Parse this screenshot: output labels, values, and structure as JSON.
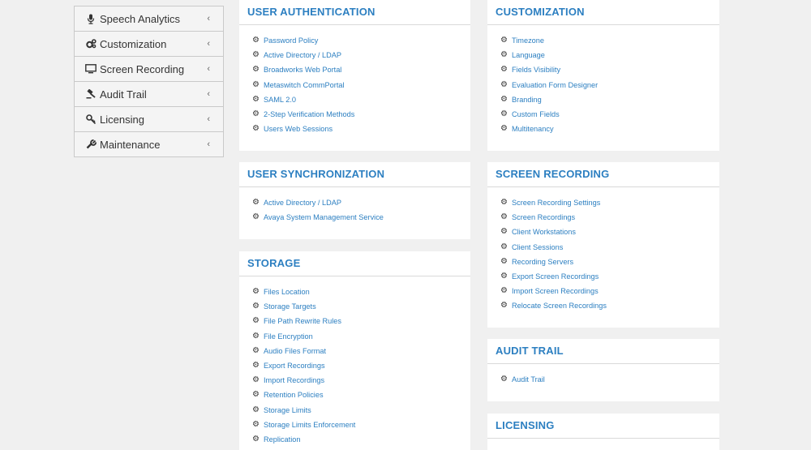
{
  "sidebar": {
    "items": [
      {
        "label": "Speech Analytics",
        "icon": "microphone-icon"
      },
      {
        "label": "Customization",
        "icon": "cogs-icon"
      },
      {
        "label": "Screen Recording",
        "icon": "monitor-icon"
      },
      {
        "label": "Audit Trail",
        "icon": "gavel-icon"
      },
      {
        "label": "Licensing",
        "icon": "key-icon"
      },
      {
        "label": "Maintenance",
        "icon": "wrench-icon"
      }
    ]
  },
  "panels": {
    "user_auth": {
      "title": "USER AUTHENTICATION",
      "items": [
        "Password Policy",
        "Active Directory / LDAP",
        "Broadworks Web Portal",
        "Metaswitch CommPortal",
        "SAML 2.0",
        "2-Step Verification Methods",
        "Users Web Sessions"
      ]
    },
    "user_sync": {
      "title": "USER SYNCHRONIZATION",
      "items": [
        "Active Directory / LDAP",
        "Avaya System Management Service"
      ]
    },
    "storage": {
      "title": "STORAGE",
      "items": [
        "Files Location",
        "Storage Targets",
        "File Path Rewrite Rules",
        "File Encryption",
        "Audio Files Format",
        "Export Recordings",
        "Import Recordings",
        "Retention Policies",
        "Storage Limits",
        "Storage Limits Enforcement",
        "Replication"
      ]
    },
    "customization": {
      "title": "CUSTOMIZATION",
      "items": [
        "Timezone",
        "Language",
        "Fields Visibility",
        "Evaluation Form Designer",
        "Branding",
        "Custom Fields",
        "Multitenancy"
      ]
    },
    "screen_recording": {
      "title": "SCREEN RECORDING",
      "items": [
        "Screen Recording Settings",
        "Screen Recordings",
        "Client Workstations",
        "Client Sessions",
        "Recording Servers",
        "Export Screen Recordings",
        "Import Screen Recordings",
        "Relocate Screen Recordings"
      ]
    },
    "audit_trail": {
      "title": "AUDIT TRAIL",
      "items": [
        "Audit Trail"
      ]
    },
    "licensing": {
      "title": "LICENSING",
      "items": []
    }
  },
  "colors": {
    "link": "#2c7fc1",
    "background": "#f0f0f0",
    "panel": "#ffffff"
  }
}
